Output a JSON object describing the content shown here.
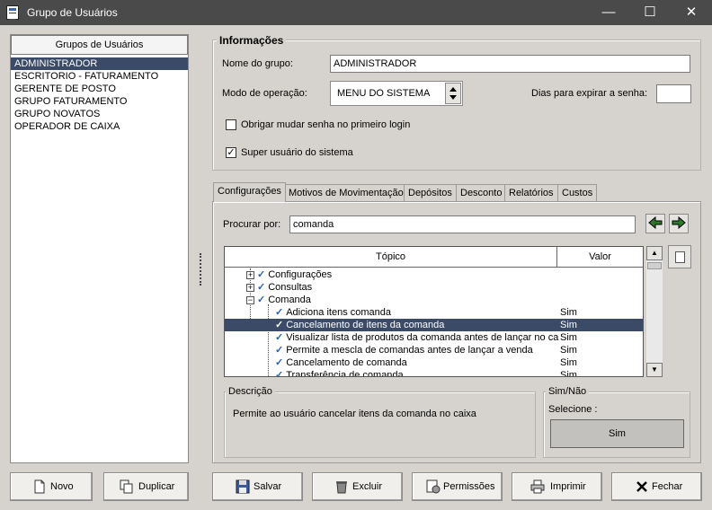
{
  "window": {
    "title": "Grupo de Usuários",
    "minimize": "—",
    "maximize": "☐",
    "close": "✕"
  },
  "groups_panel": {
    "header": "Grupos de Usuários",
    "items": [
      "ADMINISTRADOR",
      "ESCRITORIO - FATURAMENTO",
      "GERENTE DE POSTO",
      "GRUPO FATURAMENTO",
      "GRUPO NOVATOS",
      "OPERADOR DE CAIXA"
    ],
    "selected": "ADMINISTRADOR"
  },
  "info": {
    "legend": "Informações",
    "group_name_label": "Nome do grupo:",
    "group_name_value": "ADMINISTRADOR",
    "mode_label": "Modo de operação:",
    "mode_value": "MENU DO SISTEMA",
    "expire_label": "Dias para expirar a senha:",
    "expire_value": "",
    "force_change_label": "Obrigar mudar senha no primeiro login",
    "force_change_checked": false,
    "super_user_label": "Super usuário do sistema",
    "super_user_checked": true,
    "check_mark": "✓"
  },
  "tabs": [
    {
      "label": "Configurações",
      "active": true
    },
    {
      "label": "Motivos de Movimentação",
      "active": false
    },
    {
      "label": "Depósitos",
      "active": false
    },
    {
      "label": "Desconto",
      "active": false
    },
    {
      "label": "Relatórios",
      "active": false
    },
    {
      "label": "Custos",
      "active": false
    }
  ],
  "search": {
    "label": "Procurar por:",
    "value": "comanda"
  },
  "grid": {
    "col_topic": "Tópico",
    "col_value": "Valor",
    "rows": [
      {
        "label": "Configurações",
        "value": "",
        "expander": "+"
      },
      {
        "label": "Consultas",
        "value": "",
        "expander": "+"
      },
      {
        "label": "Comanda",
        "value": "",
        "expander": "−"
      },
      {
        "label": "Adiciona itens comanda",
        "value": "Sim",
        "expander": ""
      },
      {
        "label": "Cancelamento de itens da comanda",
        "value": "Sim",
        "expander": "",
        "selected": true
      },
      {
        "label": "Visualizar lista de produtos da comanda antes de lançar no ca",
        "value": "Sim",
        "expander": ""
      },
      {
        "label": "Permite a mescla de comandas antes de lançar a venda",
        "value": "Sim",
        "expander": ""
      },
      {
        "label": "Cancelamento de comanda",
        "value": "Sim",
        "expander": ""
      },
      {
        "label": "Transferência de comanda",
        "value": "Sim",
        "expander": ""
      }
    ]
  },
  "description": {
    "legend": "Descrição",
    "text": "Permite ao usuário cancelar itens da comanda no caixa"
  },
  "simnao": {
    "legend": "Sim/Não",
    "select_label": "Selecione :",
    "value": "Sim"
  },
  "buttons": {
    "novo": "Novo",
    "duplicar": "Duplicar",
    "salvar": "Salvar",
    "excluir": "Excluir",
    "permissoes": "Permissões",
    "imprimir": "Imprimir",
    "fechar": "Fechar"
  },
  "colors": {
    "selection": "#3b4a66",
    "titlebar": "#4a4a4a",
    "face": "#d6d3ce"
  }
}
